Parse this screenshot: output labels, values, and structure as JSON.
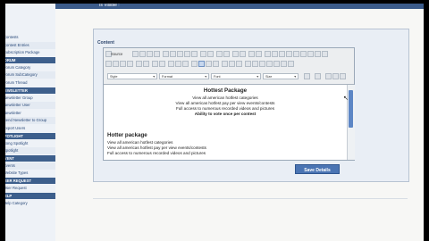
{
  "sidebar": {
    "items": [
      {
        "label": "Contests",
        "kind": "item"
      },
      {
        "label": "Contest Entries",
        "kind": "item"
      },
      {
        "label": "Subscription Package",
        "kind": "item"
      },
      {
        "label": "FORUM",
        "kind": "head"
      },
      {
        "label": "Forum Category",
        "kind": "item"
      },
      {
        "label": "Forum SubCategory",
        "kind": "item"
      },
      {
        "label": "Forum Thread",
        "kind": "item"
      },
      {
        "label": "NEWSLETTER",
        "kind": "head"
      },
      {
        "label": "Newsletter Group",
        "kind": "item"
      },
      {
        "label": "Newsletter User",
        "kind": "item"
      },
      {
        "label": "Newsletter",
        "kind": "item"
      },
      {
        "label": "Send Newsletter to Group",
        "kind": "item"
      },
      {
        "label": "Export Users",
        "kind": "item"
      },
      {
        "label": "SPOTLIGHT",
        "kind": "head"
      },
      {
        "label": "Song Spotlight",
        "kind": "item"
      },
      {
        "label": "Spotlight",
        "kind": "item"
      },
      {
        "label": "EVENT",
        "kind": "head"
      },
      {
        "label": "Events",
        "kind": "item"
      },
      {
        "label": "Website Types",
        "kind": "item"
      },
      {
        "label": "USER REQUEST",
        "kind": "head"
      },
      {
        "label": "User Request",
        "kind": "item"
      },
      {
        "label": "HELP",
        "kind": "head"
      },
      {
        "label": "Help Category",
        "kind": "item"
      }
    ]
  },
  "main": {
    "visible_label": "Is Visible :",
    "content_label": "Content",
    "toolbar": {
      "source_label": "Source",
      "style_combo": "Style",
      "format_combo": "Format",
      "font_combo": "Font",
      "size_combo": "Size"
    },
    "content": {
      "package1_title": "Hottest Package",
      "package1_lines": [
        "View all american hotfest categories",
        "View all americas hotfest pay per view events/contests",
        "Full access to numerous recorded videos and pictures"
      ],
      "package1_bold": "Ability to vote once per contest",
      "package2_title": "Hotter package",
      "package2_lines": [
        "View all american hotfest categories",
        "View all americas hotfest pay per view events/contests",
        "Full access to numerous recorded videos and pictures"
      ]
    },
    "save_label": "Save Details"
  },
  "colors": {
    "sidebar_head": "#3d5f8c",
    "accent": "#4a74b3",
    "scroll_thumb": "#5d86c5"
  }
}
